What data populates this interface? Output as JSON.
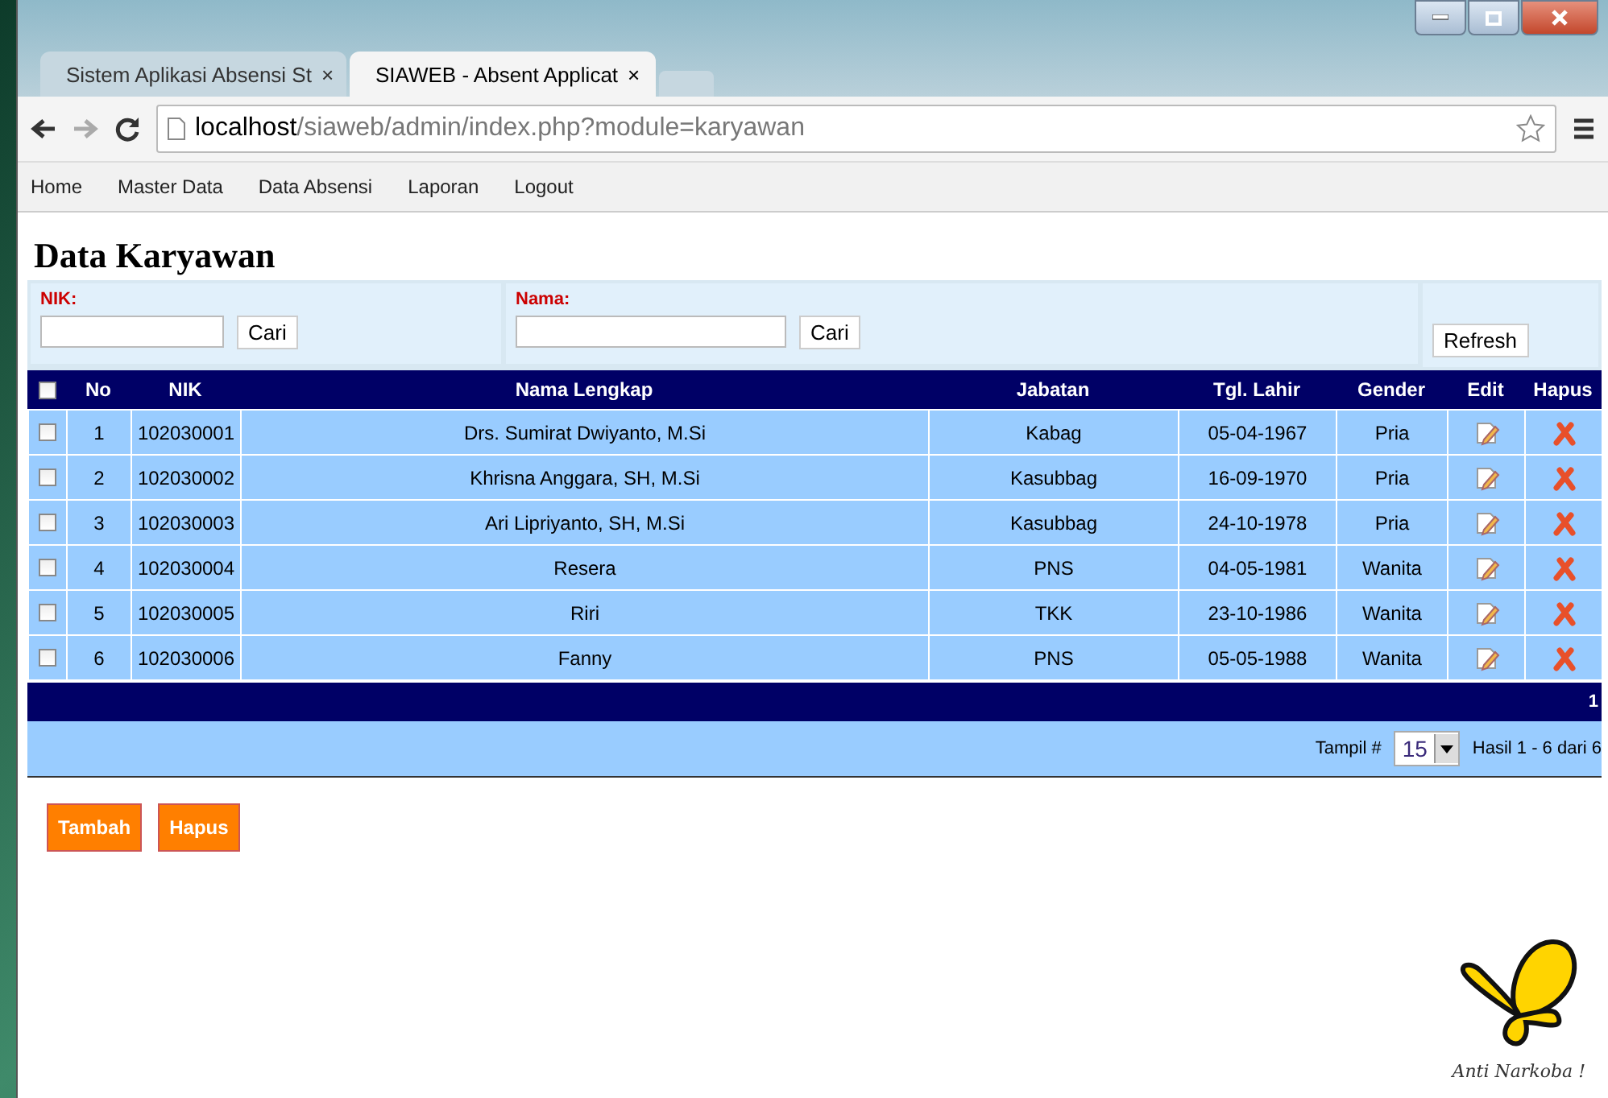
{
  "tabs": [
    {
      "label": "Sistem Aplikasi Absensi St",
      "selected": false
    },
    {
      "label": "SIAWEB - Absent Applicat",
      "selected": true
    }
  ],
  "tab_close": "×",
  "address": {
    "host": "localhost",
    "path": "/siaweb/admin/index.php?module=karyawan"
  },
  "menu": [
    "Home",
    "Master Data",
    "Data Absensi",
    "Laporan",
    "Logout"
  ],
  "page_title": "Data Karyawan",
  "search": [
    {
      "label": "NIK:",
      "button": "Cari"
    },
    {
      "label": "Nama:",
      "button": "Cari"
    }
  ],
  "refresh_button": "Refresh",
  "table": {
    "all_checked": false,
    "columns": [
      "No",
      "NIK",
      "Nama Lengkap",
      "Jabatan",
      "Tgl. Lahir",
      "Gender",
      "Edit",
      "Hapus"
    ],
    "rows": [
      {
        "checked": false,
        "cells": [
          "1",
          "102030001",
          "Drs. Sumirat Dwiyanto, M.Si",
          "Kabag",
          "05-04-1967",
          "Pria"
        ]
      },
      {
        "checked": false,
        "cells": [
          "2",
          "102030002",
          "Khrisna Anggara, SH, M.Si",
          "Kasubbag",
          "16-09-1970",
          "Pria"
        ]
      },
      {
        "checked": false,
        "cells": [
          "3",
          "102030003",
          "Ari Lipriyanto, SH, M.Si",
          "Kasubbag",
          "24-10-1978",
          "Pria"
        ]
      },
      {
        "checked": false,
        "cells": [
          "4",
          "102030004",
          "Resera",
          "PNS",
          "04-05-1981",
          "Wanita"
        ]
      },
      {
        "checked": false,
        "cells": [
          "5",
          "102030005",
          "Riri",
          "TKK",
          "23-10-1986",
          "Wanita"
        ]
      },
      {
        "checked": false,
        "cells": [
          "6",
          "102030006",
          "Fanny",
          "PNS",
          "05-05-1988",
          "Wanita"
        ]
      }
    ],
    "page": "1",
    "tampil_label": "Tampil #",
    "tampil_value": "15",
    "result": "Hasil 1 - 6 dari 6"
  },
  "buttons": [
    "Tambah",
    "Hapus"
  ],
  "logo_caption": "Anti Narkoba !"
}
